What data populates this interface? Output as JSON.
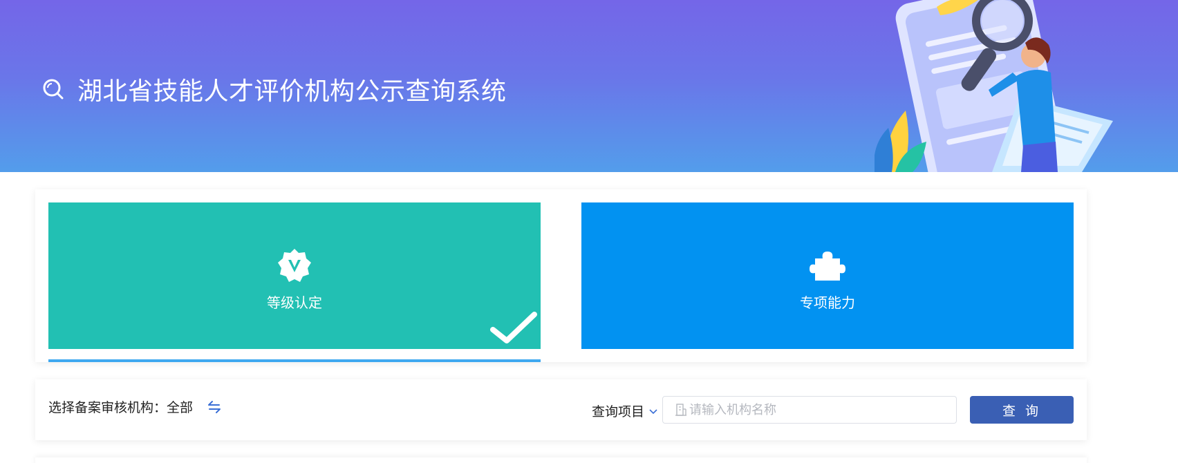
{
  "header": {
    "title": "湖北省技能人才评价机构公示查询系统",
    "icon": "search-icon"
  },
  "cards": [
    {
      "label": "等级认定",
      "icon": "badge-v-icon",
      "selected": true,
      "color": "#22c0b3"
    },
    {
      "label": "专项能力",
      "icon": "puzzle-icon",
      "selected": false,
      "color": "#0292f1"
    }
  ],
  "filter": {
    "org_label": "选择备案审核机构：",
    "org_value": "全部",
    "query_type": "查询项目",
    "search_placeholder": "请输入机构名称",
    "search_value": "",
    "query_button": "查 询"
  },
  "colors": {
    "accent": "#3a5fb4",
    "banner_top": "#7466e8",
    "banner_bottom": "#539deb"
  }
}
